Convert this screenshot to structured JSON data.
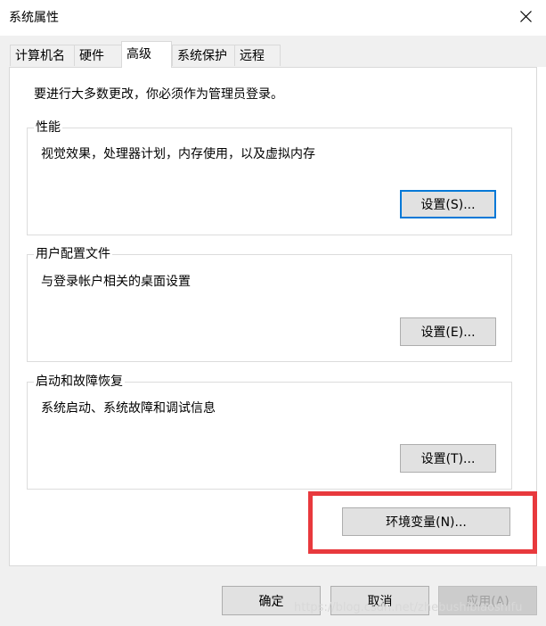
{
  "window": {
    "title": "系统属性"
  },
  "tabs": [
    {
      "label": "计算机名",
      "active": false
    },
    {
      "label": "硬件",
      "active": false
    },
    {
      "label": "高级",
      "active": true
    },
    {
      "label": "系统保护",
      "active": false
    },
    {
      "label": "远程",
      "active": false
    }
  ],
  "advanced": {
    "notice": "要进行大多数更改，你必须作为管理员登录。",
    "performance": {
      "label": "性能",
      "description": "视觉效果，处理器计划，内存使用，以及虚拟内存",
      "button": "设置(S)..."
    },
    "user_profiles": {
      "label": "用户配置文件",
      "description": "与登录帐户相关的桌面设置",
      "button": "设置(E)..."
    },
    "startup_recovery": {
      "label": "启动和故障恢复",
      "description": "系统启动、系统故障和调试信息",
      "button": "设置(T)..."
    },
    "env_button": "环境变量(N)..."
  },
  "footer": {
    "ok": "确定",
    "cancel": "取消",
    "apply": "应用(A)"
  },
  "watermark": "https://blog.csdn.net/zhebushibiaoshifu",
  "colors": {
    "highlight": "#e8393d",
    "focus": "#0078d7"
  }
}
